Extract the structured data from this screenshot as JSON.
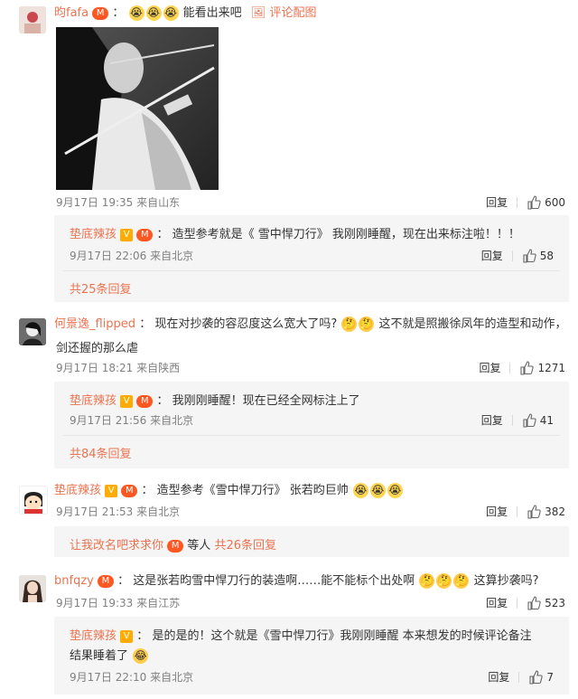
{
  "comments": [
    {
      "user": "昀fafa",
      "text": "能看出来吧",
      "meta": "9月17日 19:35 来自山东",
      "reply_label": "回复",
      "likes": "600",
      "photo_link": "评论配图",
      "replies": [
        {
          "user": "垫底辣孩",
          "text": "造型参考就是《 雪中悍刀行》 我刚刚睡醒，现在出来标注啦！！！",
          "meta": "9月17日 22:06 来自北京",
          "reply_label": "回复",
          "likes": "58"
        }
      ],
      "more": "共25条回复"
    },
    {
      "user": "何景逸_flipped",
      "text1": "现在对抄袭的容忍度这么宽大了吗?",
      "text2": "这不就是照搬徐凤年的造型和动作，",
      "text3": "剑还握的那么虐",
      "meta": "9月17日 18:21 来自陕西",
      "reply_label": "回复",
      "likes": "1271",
      "replies": [
        {
          "user": "垫底辣孩",
          "text": "我刚刚睡醒！现在已经全网标注上了",
          "meta": "9月17日 21:56 来自北京",
          "reply_label": "回复",
          "likes": "41"
        }
      ],
      "more": "共84条回复"
    },
    {
      "user": "垫底辣孩",
      "text": "造型参考《雪中悍刀行》 张若昀巨帅",
      "meta": "9月17日 21:53 来自北京",
      "reply_label": "回复",
      "likes": "382",
      "more_prefix": "让我改名吧求求你",
      "more_mid": "等人",
      "more": "共26条回复"
    },
    {
      "user": "bnfqzy",
      "text1": "这是张若昀雪中悍刀行的装造啊……能不能标个出处啊",
      "text2": "这算抄袭吗?",
      "meta": "9月17日 19:33 来自江苏",
      "reply_label": "回复",
      "likes": "523",
      "replies": [
        {
          "user": "垫底辣孩",
          "text1": "是的是的！这个就是《雪中悍刀行》我刚刚睡醒 本来想发的时候评论备注",
          "text2": "结果睡着了",
          "meta": "9月17日 22:10 来自北京",
          "reply_label": "回复",
          "likes": "7"
        }
      ]
    }
  ],
  "badges": {
    "v": "V",
    "member": "M"
  },
  "colors": {
    "link": "#eb7350",
    "reply_bg": "#f5f5f5"
  },
  "icons": [
    "thumbs-up-icon",
    "image-icon",
    "crying-emoji",
    "laughing-emoji"
  ]
}
